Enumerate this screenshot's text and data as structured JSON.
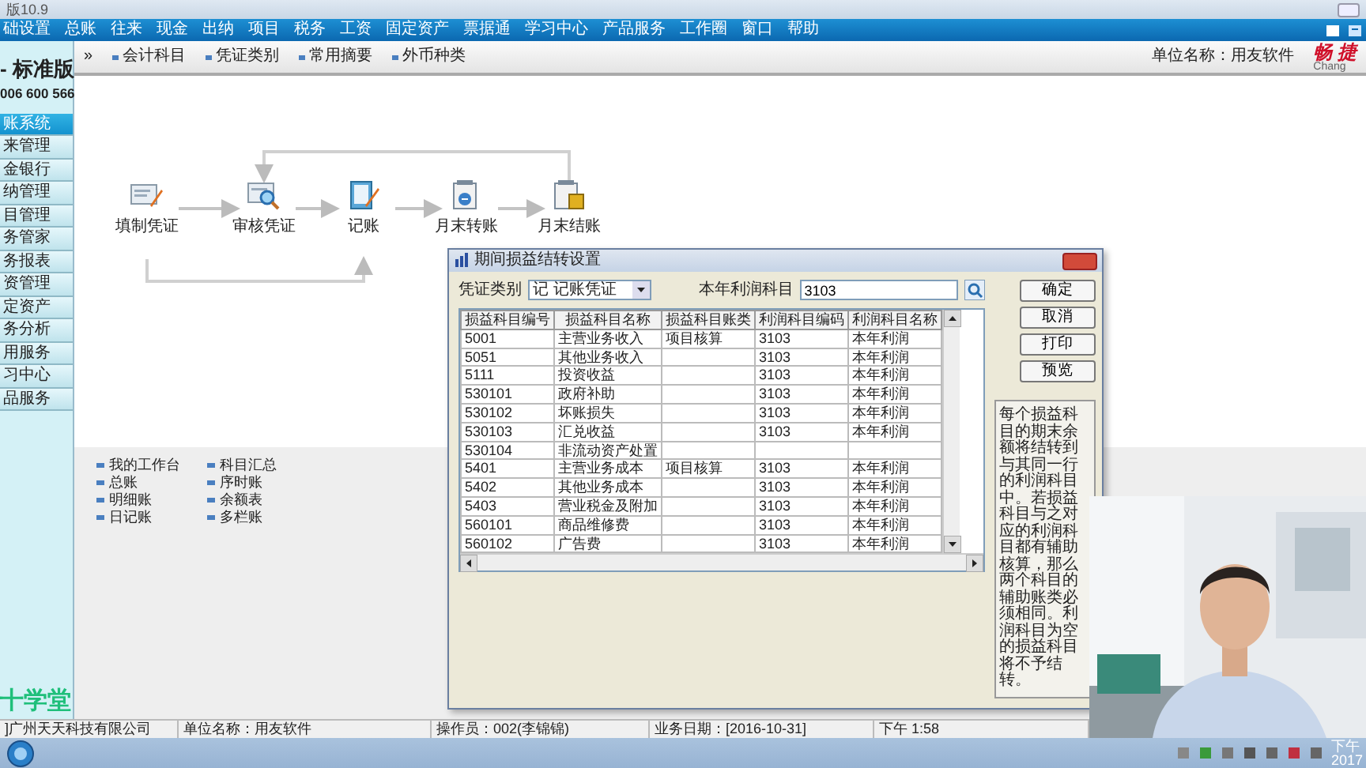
{
  "window": {
    "title": "版10.9"
  },
  "menu": [
    "础设置",
    "总账",
    "往来",
    "现金",
    "出纳",
    "项目",
    "税务",
    "工资",
    "固定资产",
    "票据通",
    "学习中心",
    "产品服务",
    "工作圈",
    "窗口",
    "帮助"
  ],
  "brand": {
    "title": "- 标准版",
    "phone": "006 600 566",
    "footer": "十学堂"
  },
  "sidebar": [
    {
      "label": "账系统",
      "selected": true
    },
    {
      "label": "来管理",
      "selected": false
    },
    {
      "label": "金银行",
      "selected": false
    },
    {
      "label": "纳管理",
      "selected": false
    },
    {
      "label": "目管理",
      "selected": false
    },
    {
      "label": "务管家",
      "selected": false
    },
    {
      "label": "务报表",
      "selected": false
    },
    {
      "label": "资管理",
      "selected": false
    },
    {
      "label": "定资产",
      "selected": false
    },
    {
      "label": "务分析",
      "selected": false
    },
    {
      "label": "用服务",
      "selected": false
    },
    {
      "label": "习中心",
      "selected": false
    },
    {
      "label": "品服务",
      "selected": false
    }
  ],
  "toolbar": {
    "expand": "»",
    "links": [
      "会计科目",
      "凭证类别",
      "常用摘要",
      "外币种类"
    ],
    "unit": "单位名称：用友软件",
    "logo": "畅 捷",
    "logo_sub": "Chang"
  },
  "flow": [
    {
      "label": "填制凭证",
      "kind": "edit"
    },
    {
      "label": "审核凭证",
      "kind": "review"
    },
    {
      "label": "记账",
      "kind": "ledger"
    },
    {
      "label": "月末转账",
      "kind": "transfer"
    },
    {
      "label": "月末结账",
      "kind": "close"
    }
  ],
  "links": [
    "我的工作台",
    "总账",
    "明细账",
    "日记账",
    "科目汇总",
    "序时账",
    "余额表",
    "多栏账"
  ],
  "dialog": {
    "title": "期间损益结转设置",
    "voucher_label": "凭证类别",
    "voucher_value": "记  记账凭证",
    "profit_label": "本年利润科目",
    "profit_value": "3103",
    "buttons": [
      "确定",
      "取消",
      "打印",
      "预览"
    ],
    "columns": [
      "损益科目编号",
      "损益科目名称",
      "损益科目账类",
      "利润科目编码",
      "利润科目名称"
    ],
    "rows": [
      [
        "5001",
        "主营业务收入",
        "项目核算",
        "3103",
        "本年利润"
      ],
      [
        "5051",
        "其他业务收入",
        "",
        "3103",
        "本年利润"
      ],
      [
        "5111",
        "投资收益",
        "",
        "3103",
        "本年利润"
      ],
      [
        "530101",
        "政府补助",
        "",
        "3103",
        "本年利润"
      ],
      [
        "530102",
        "坏账损失",
        "",
        "3103",
        "本年利润"
      ],
      [
        "530103",
        "汇兑收益",
        "",
        "3103",
        "本年利润"
      ],
      [
        "530104",
        "非流动资产处置",
        "",
        "",
        ""
      ],
      [
        "5401",
        "主营业务成本",
        "项目核算",
        "3103",
        "本年利润"
      ],
      [
        "5402",
        "其他业务成本",
        "",
        "3103",
        "本年利润"
      ],
      [
        "5403",
        "营业税金及附加",
        "",
        "3103",
        "本年利润"
      ],
      [
        "560101",
        "商品维修费",
        "",
        "3103",
        "本年利润"
      ],
      [
        "560102",
        "广告费",
        "",
        "3103",
        "本年利润"
      ]
    ],
    "note": "每个损益科目的期末余额将结转到与其同一行的利润科目中。若损益科目与之对应的利润科目都有辅助核算，那么两个科目的辅助账类必须相同。利润科目为空的损益科目将不予结转。"
  },
  "status_bar": [
    "]广州天天科技有限公司",
    "单位名称：用友软件",
    "操作员：002(李锦锦)",
    "业务日期：[2016-10-31]",
    "下午 1:58"
  ],
  "taskbar": {
    "time": "下午",
    "date": "2017"
  }
}
